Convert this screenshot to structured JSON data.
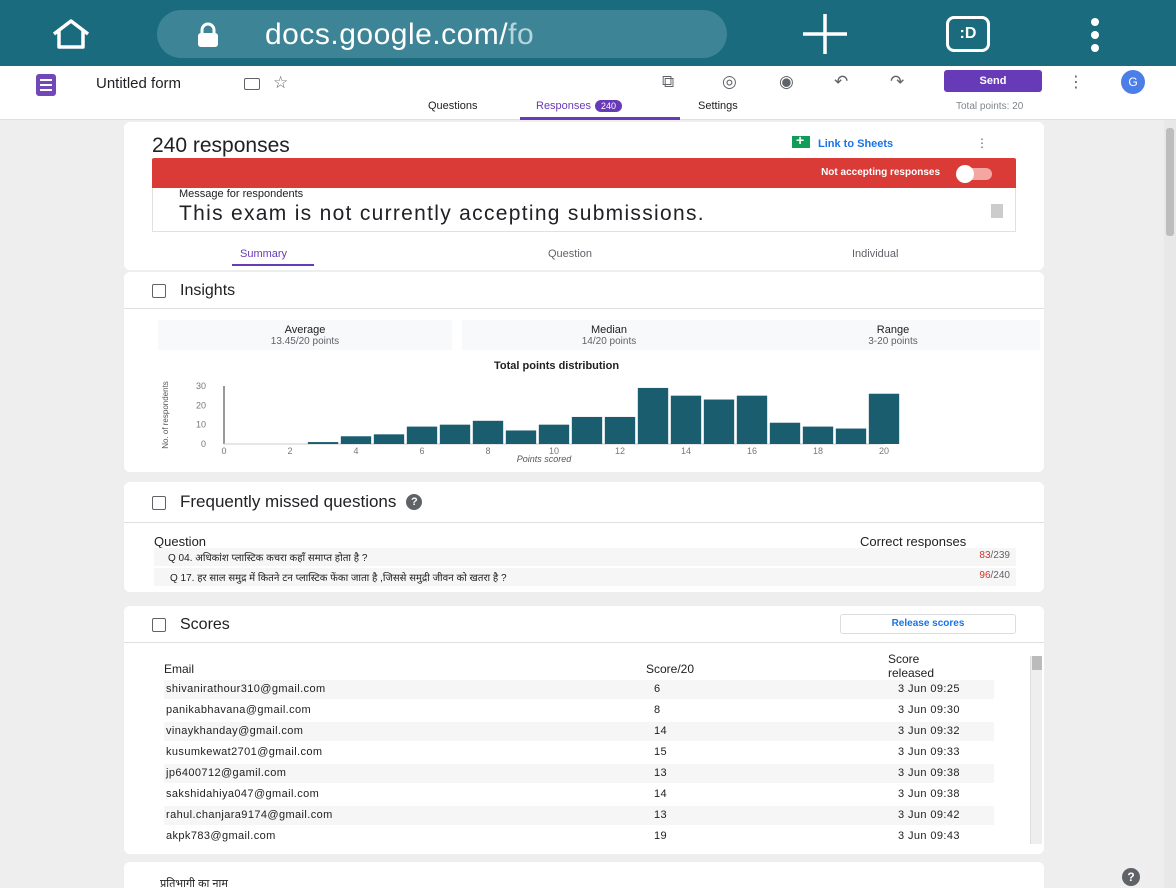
{
  "browser": {
    "url_main": "docs.google.com/",
    "url_dim": "fo",
    "tabs_label": ":D"
  },
  "form": {
    "title": "Untitled form",
    "send_label": "Send",
    "avatar_letter": "G",
    "tabs": [
      {
        "label": "Questions"
      },
      {
        "label": "Responses",
        "count": "240"
      },
      {
        "label": "Settings"
      }
    ],
    "total_points": "Total points: 20"
  },
  "responses": {
    "title": "240 responses",
    "link_sheets": "Link to Sheets",
    "accepting_label": "Not accepting responses",
    "accepting": false,
    "message_label": "Message for respondents",
    "message": "This exam is not currently accepting submissions.",
    "subtabs": [
      "Summary",
      "Question",
      "Individual"
    ]
  },
  "insights": {
    "title": "Insights",
    "stats": [
      {
        "label": "Average",
        "value": "13.45/20 points"
      },
      {
        "label": "Median",
        "value": "14/20 points"
      },
      {
        "label": "Range",
        "value": "3-20 points"
      }
    ]
  },
  "chart_data": {
    "type": "bar",
    "title": "Total points distribution",
    "xlabel": "Points scored",
    "ylabel": "No. of respondents",
    "x": [
      3,
      4,
      5,
      6,
      7,
      8,
      9,
      10,
      11,
      12,
      13,
      14,
      15,
      16,
      17,
      18,
      19,
      20
    ],
    "values": [
      1,
      4,
      5,
      9,
      10,
      12,
      7,
      10,
      14,
      14,
      29,
      25,
      23,
      25,
      11,
      9,
      8,
      26
    ],
    "xlim": [
      0,
      20
    ],
    "ylim": [
      0,
      30
    ],
    "xticks": [
      "0",
      "2",
      "4",
      "6",
      "8",
      "10",
      "12",
      "14",
      "16",
      "18",
      "20"
    ],
    "yticks": [
      "0",
      "10",
      "20",
      "30"
    ],
    "color": "#1a5d6f"
  },
  "missed": {
    "title": "Frequently missed questions",
    "col_question": "Question",
    "col_correct": "Correct responses",
    "rows": [
      {
        "question": "Q 04.  अधिकांश प्लास्टिक कचरा कहाँ समाप्त होता है ?",
        "correct": "83",
        "total": "/239"
      },
      {
        "question": "Q 17. हर साल समुद्र में कितने टन प्लास्टिक फेंका जाता है ,जिससे समुद्री जीवन को खतरा है ?",
        "correct": "96",
        "total": "/240"
      }
    ]
  },
  "scores": {
    "title": "Scores",
    "release_label": "Release scores",
    "col_email": "Email",
    "col_score": "Score/20",
    "col_released_1": "Score",
    "col_released_2": "released",
    "rows": [
      {
        "email": "shivanirathour310@gmail.com",
        "score": "6",
        "released": "3 Jun 09:25"
      },
      {
        "email": "panikabhavana@gmail.com",
        "score": "8",
        "released": "3 Jun 09:30"
      },
      {
        "email": "vinaykhanday@gmail.com",
        "score": "14",
        "released": "3 Jun 09:32"
      },
      {
        "email": "kusumkewat2701@gmail.com",
        "score": "15",
        "released": "3 Jun 09:33"
      },
      {
        "email": "jp6400712@gamil.com",
        "score": "13",
        "released": "3 Jun 09:38"
      },
      {
        "email": "sakshidahiya047@gmail.com",
        "score": "14",
        "released": "3 Jun 09:38"
      },
      {
        "email": "rahul.chanjara9174@gmail.com",
        "score": "13",
        "released": "3 Jun 09:42"
      },
      {
        "email": "akpk783@gmail.com",
        "score": "19",
        "released": "3 Jun 09:43"
      }
    ]
  },
  "next_section": {
    "label": "प्रतिभागी का नाम"
  },
  "help_label": "?"
}
